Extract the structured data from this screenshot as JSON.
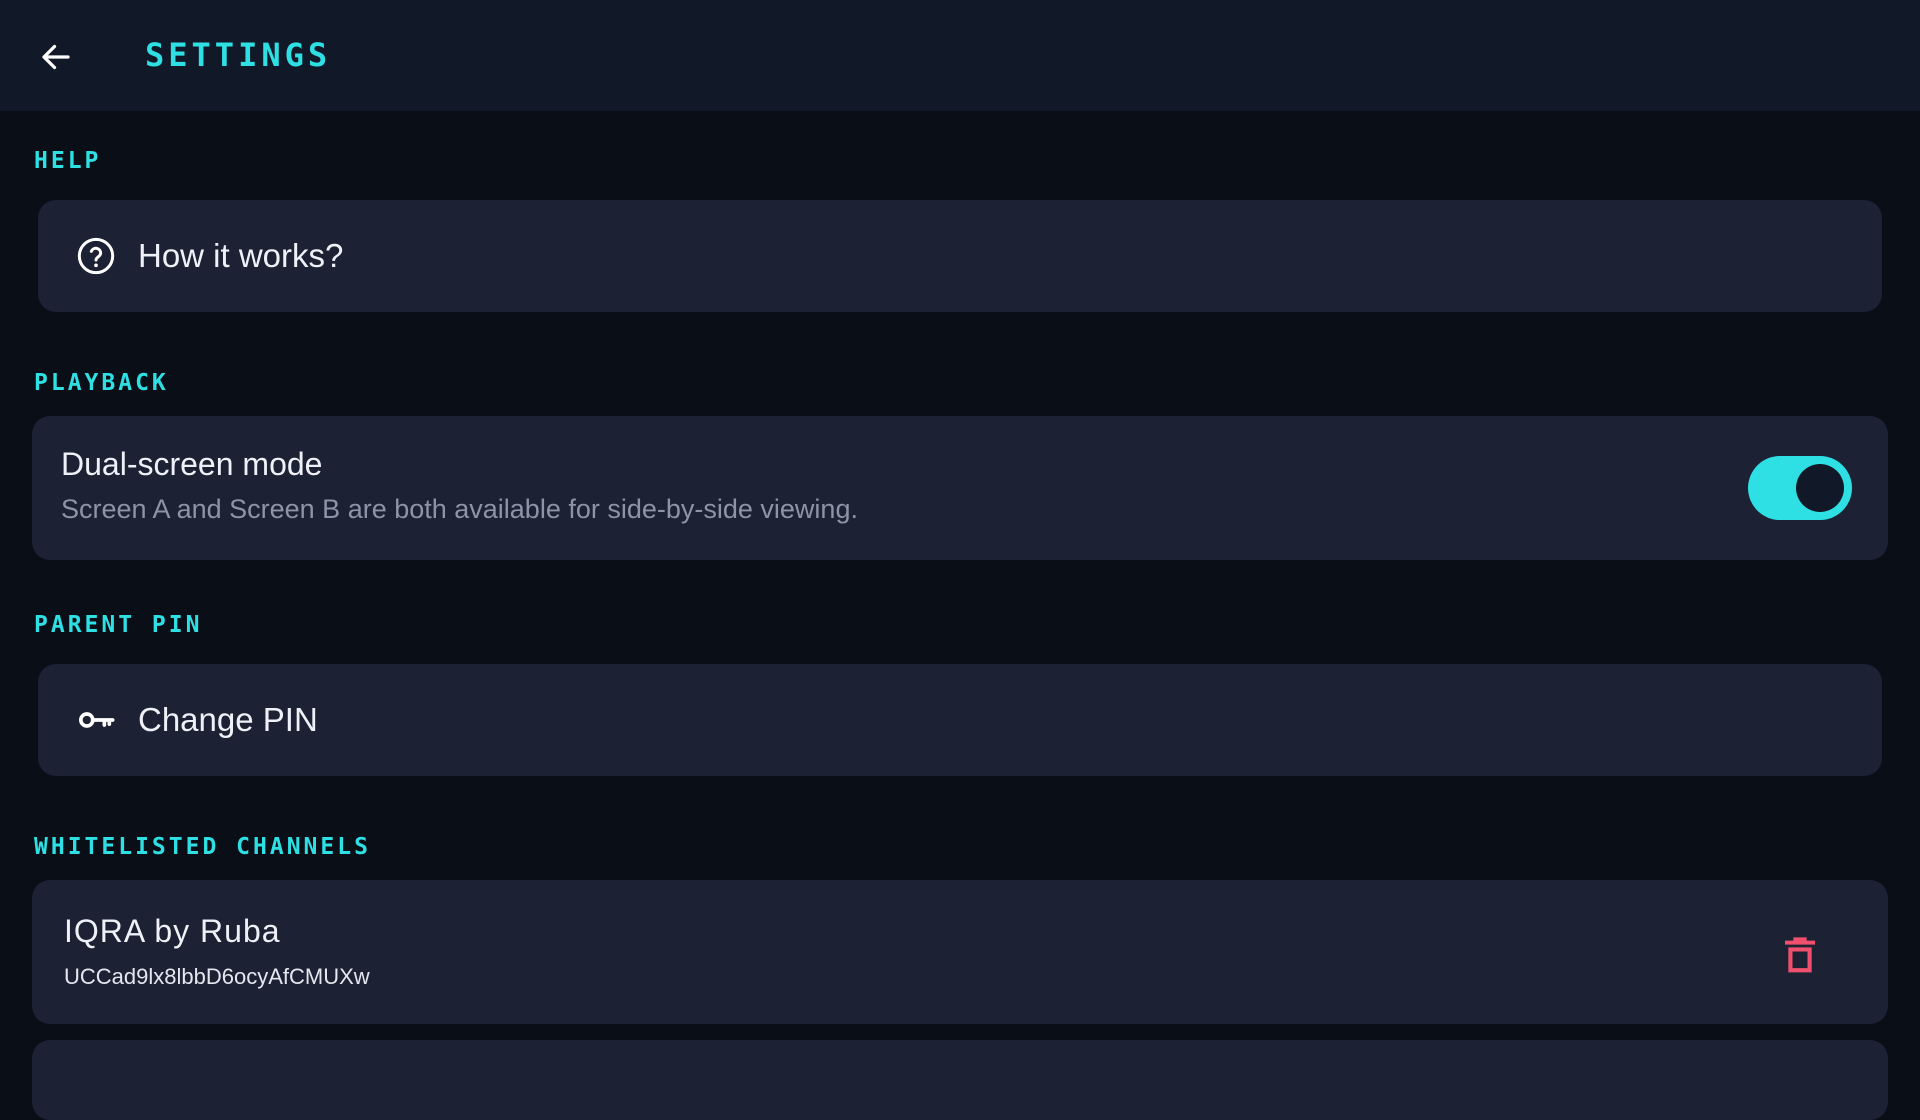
{
  "header": {
    "back_icon": "arrow-left-icon",
    "title": "Settings"
  },
  "sections": {
    "help": {
      "title": "Help",
      "item": {
        "icon": "help-circle-icon",
        "label": "How it works?"
      }
    },
    "playback": {
      "title": "Playback",
      "toggle": {
        "title": "Dual-screen mode",
        "subtitle": "Screen A and Screen B are both available for side-by-side viewing.",
        "enabled": true
      }
    },
    "parent_pin": {
      "title": "Parent PIN",
      "item": {
        "icon": "key-icon",
        "label": "Change PIN"
      }
    },
    "whitelisted_channels": {
      "title": "Whitelisted Channels",
      "channels": [
        {
          "name": "IQRA by Ruba",
          "id": "UCCad9lx8lbbD6ocyAfCMUXw",
          "action_icon": "trash-icon"
        }
      ]
    }
  },
  "colors": {
    "accent": "#2ee0e4",
    "background": "#0a0e17",
    "appbar": "#111827",
    "card": "#1c2133",
    "danger": "#f0506e"
  }
}
